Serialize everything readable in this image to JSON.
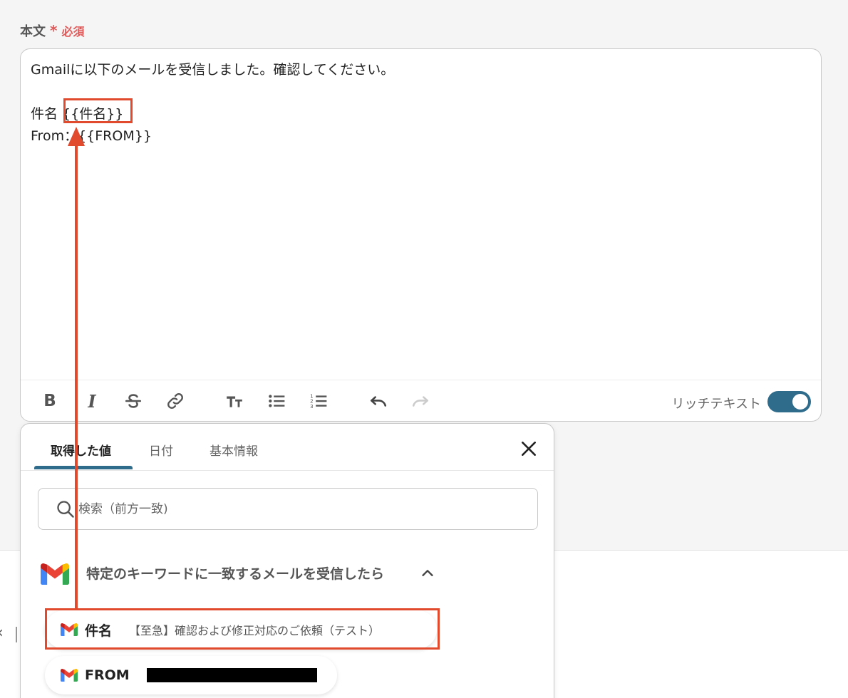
{
  "field": {
    "label": "本文",
    "required_mark": "*",
    "required_text": "必須"
  },
  "editor": {
    "lines": [
      "Gmailに以下のメールを受信しました。確認してください。",
      "",
      "件名 {{件名}}",
      "From：{{FROM}}"
    ],
    "toolbar": {
      "bold": "B",
      "italic": "I",
      "rich_text_label": "リッチテキスト",
      "rich_text_enabled": true
    }
  },
  "panel": {
    "tabs": [
      {
        "label": "取得した値",
        "active": true
      },
      {
        "label": "日付",
        "active": false
      },
      {
        "label": "基本情報",
        "active": false
      }
    ],
    "search": {
      "placeholder": "検索（前方一致)",
      "value": ""
    },
    "group": {
      "title": "特定のキーワードに一致するメールを受信したら",
      "expanded": true,
      "items": [
        {
          "key": "件名",
          "value": "【至急】確認および修正対応のご依頼（テスト）"
        },
        {
          "key": "FROM",
          "value": ""
        }
      ]
    }
  },
  "colors": {
    "accent": "#2f6c8c",
    "required": "#e05a5a",
    "highlight": "#e24a2e"
  }
}
